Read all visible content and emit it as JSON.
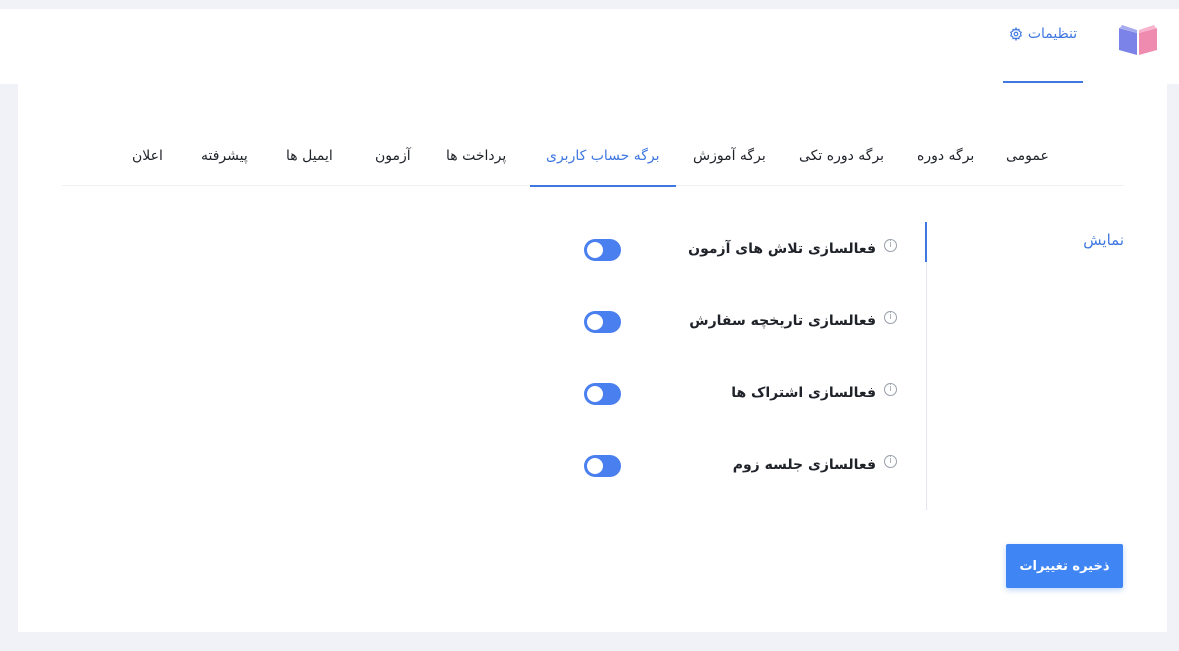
{
  "header": {
    "logo_icon": "book-icon",
    "settings_tab": {
      "label": "تنظیمات",
      "icon": "gear-icon"
    }
  },
  "tabs": [
    {
      "label": "عمومی",
      "active": false
    },
    {
      "label": "برگه دوره",
      "active": false
    },
    {
      "label": "برگه دوره تکی",
      "active": false
    },
    {
      "label": "برگه آموزش",
      "active": false
    },
    {
      "label": "برگه حساب کاربری",
      "active": true
    },
    {
      "label": "پرداخت ها",
      "active": false
    },
    {
      "label": "آزمون",
      "active": false
    },
    {
      "label": "ایمیل ها",
      "active": false
    },
    {
      "label": "پیشرفته",
      "active": false
    },
    {
      "label": "اعلان",
      "active": false
    }
  ],
  "section": {
    "label": "نمایش"
  },
  "settings": [
    {
      "label": "فعالسازی تلاش های آزمون",
      "enabled": true
    },
    {
      "label": "فعالسازی تاریخچه سفارش",
      "enabled": true
    },
    {
      "label": "فعالسازی اشتراک ها",
      "enabled": true
    },
    {
      "label": "فعالسازی جلسه زوم",
      "enabled": true
    }
  ],
  "save_button": {
    "label": "ذخیره تغییرات"
  },
  "colors": {
    "accent": "#3f78e0",
    "toggle_on": "#4a7ff0",
    "button": "#3f86f4"
  }
}
